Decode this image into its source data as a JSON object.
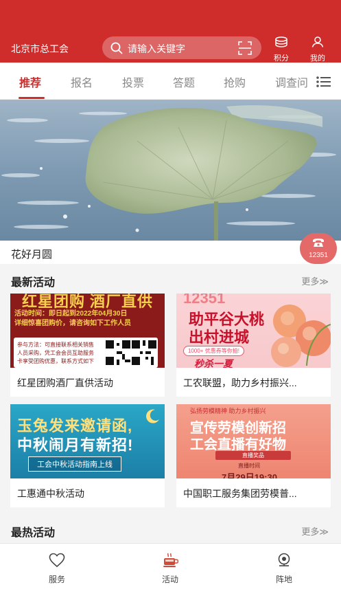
{
  "header": {
    "org_name": "北京市总工会",
    "search_placeholder": "请输入关键字",
    "points_label": "积分",
    "mine_label": "我的",
    "brand_color": "#cf2c2c"
  },
  "tabs": [
    {
      "label": "推荐",
      "active": true
    },
    {
      "label": "报名",
      "active": false
    },
    {
      "label": "投票",
      "active": false
    },
    {
      "label": "答题",
      "active": false
    },
    {
      "label": "抢购",
      "active": false
    },
    {
      "label": "调查问",
      "active": false
    }
  ],
  "banner": {
    "caption": "花好月圆",
    "hotline": "12351"
  },
  "latest": {
    "title": "最新活动",
    "more": "更多≫",
    "cards": [
      {
        "title": "红星团购酒厂直供活动",
        "img": {
          "headline": "红星团购 酒厂直供",
          "line1": "活动时间：即日起到2022年04月30日",
          "line2": "详细惊喜团购价，请咨询如下工作人员",
          "box1": "参与方法：可直接联系相关销售",
          "box2": "人员采购，凭工会会员互助服务",
          "box3": "卡享受团购优惠，联系方式如下"
        }
      },
      {
        "title": "工农联盟，助力乡村振兴...",
        "img": {
          "top": "12351",
          "line1": "助平谷大桃",
          "line2": "出村进城",
          "badge": "1000+ 优惠券等你拍!",
          "bottom": "秒杀一夏"
        }
      },
      {
        "title": "工惠通中秋活动",
        "img": {
          "line1": "玉兔发来邀请函,",
          "line2": "中秋闹月有新招!",
          "line3": "工会中秋活动指南上线"
        }
      },
      {
        "title": "中国职工服务集团劳模普...",
        "img": {
          "top": "弘扬劳模精神 助力乡村振兴",
          "line1": "宣传劳模创新招",
          "line2": "工会直播有好物",
          "pill": "直播奖品",
          "small": "直播时间",
          "time": "7月29日19:30"
        }
      }
    ]
  },
  "hottest": {
    "title": "最热活动",
    "more": "更多≫"
  },
  "bottom_nav": [
    {
      "label": "服务",
      "icon": "heart-icon",
      "active": false
    },
    {
      "label": "活动",
      "icon": "coffee-cup-icon",
      "active": true
    },
    {
      "label": "阵地",
      "icon": "location-pin-icon",
      "active": false
    }
  ]
}
